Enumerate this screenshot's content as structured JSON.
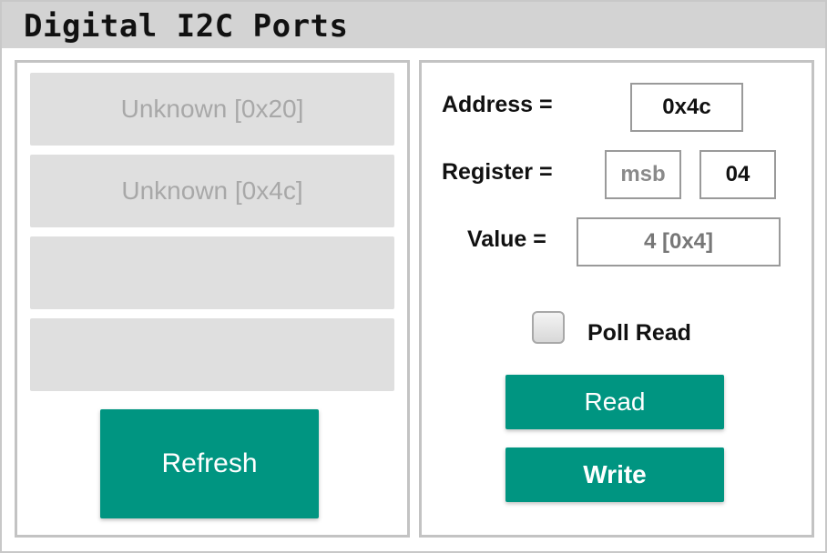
{
  "window": {
    "title": "Digital I2C Ports"
  },
  "devices": [
    {
      "label": "Unknown [0x20]"
    },
    {
      "label": "Unknown [0x4c]"
    },
    {
      "label": ""
    },
    {
      "label": ""
    }
  ],
  "left": {
    "refresh_label": "Refresh"
  },
  "form": {
    "address_label": "Address =",
    "address_value": "0x4c",
    "register_label": "Register =",
    "register_msb_placeholder": "msb",
    "register_lsb_value": "04",
    "value_label": "Value =",
    "value_display": "4 [0x4]",
    "poll_label": "Poll Read",
    "poll_checked": false,
    "read_label": "Read",
    "write_label": "Write"
  },
  "colors": {
    "accent": "#009581",
    "slot_bg": "#dfdfdf",
    "titlebar_bg": "#d3d3d3",
    "border": "#c3c3c3"
  }
}
